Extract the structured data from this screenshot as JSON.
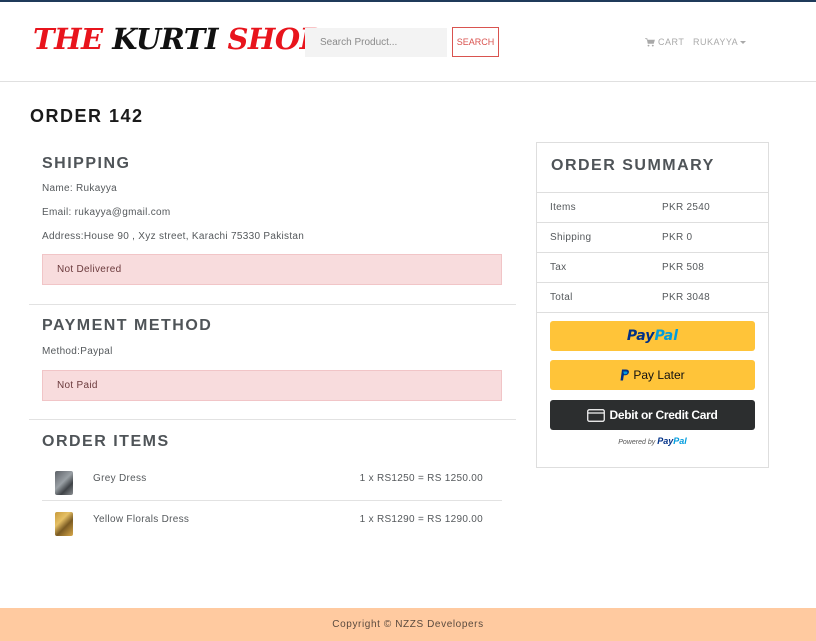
{
  "brand": {
    "part1": "THE KURTI ",
    "part2": "SHOP"
  },
  "nav": {
    "search_placeholder": "Search Product...",
    "search_button": "SEARCH",
    "cart_label": "CART",
    "user_label": "RUKAYYA"
  },
  "order": {
    "title": "ORDER 142",
    "shipping": {
      "heading": "SHIPPING",
      "name": "Name: Rukayya",
      "email_prefix": "Email: ",
      "email": "rukayya@gmail.com",
      "address": "Address:House 90 , Xyz street, Karachi 75330 Pakistan",
      "status": "Not Delivered"
    },
    "payment": {
      "heading": "PAYMENT METHOD",
      "method": "Method:Paypal",
      "status": "Not Paid"
    },
    "items": {
      "heading": "ORDER ITEMS",
      "list": [
        {
          "name": "Grey Dress",
          "price": "1 x RS1250 = RS 1250.00"
        },
        {
          "name": "Yellow Florals Dress",
          "price": "1 x RS1290 = RS 1290.00"
        }
      ]
    }
  },
  "summary": {
    "heading": "ORDER SUMMARY",
    "rows": [
      {
        "label": "Items",
        "value": "PKR 2540"
      },
      {
        "label": "Shipping",
        "value": "PKR 0"
      },
      {
        "label": "Tax",
        "value": "PKR 508"
      },
      {
        "label": "Total",
        "value": "PKR 3048"
      }
    ],
    "paypal": {
      "logo_part1": "Pay",
      "logo_part2": "Pal",
      "pay_later": "Pay Later",
      "card": "Debit or Credit Card",
      "powered_prefix": "Powered by ",
      "powered_part1": "Pay",
      "powered_part2": "Pal"
    }
  },
  "footer": {
    "text": "Copyright © NZZS Developers"
  },
  "colors": {
    "brand_red": "#e8141c",
    "alert_bg": "#f8dcdd",
    "paypal_gold": "#ffc439",
    "footer_bg": "#ffcaa0"
  },
  "icons": {
    "cart": "shopping-cart-icon",
    "dropdown": "caret-down-icon",
    "paypal": "paypal-p-icon",
    "card": "credit-card-icon"
  }
}
